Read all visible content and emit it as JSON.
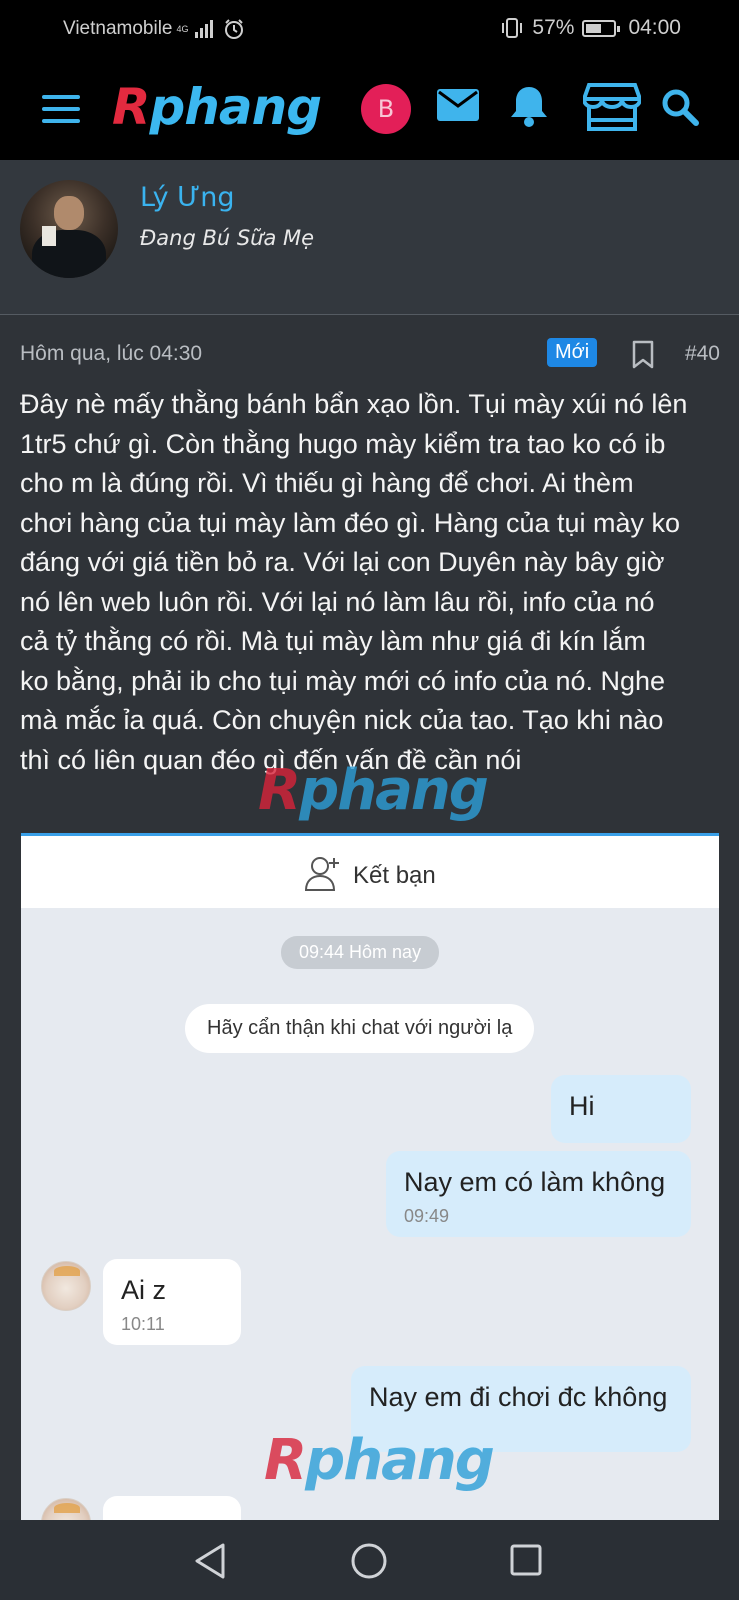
{
  "status_bar": {
    "carrier": "Vietnamobile",
    "network": "4G",
    "battery": "57%",
    "battery_level": 0.57,
    "time": "04:00"
  },
  "app_bar": {
    "logo_part1": "R",
    "logo_part2": "phang",
    "avatar_letter": "B",
    "icons": [
      "menu-icon",
      "mail-icon",
      "bell-icon",
      "store-icon",
      "search-icon"
    ]
  },
  "author": {
    "name": "Lý Ưng",
    "title": "Đang Bú Sữa Mẹ"
  },
  "post": {
    "date": "Hôm qua, lúc 04:30",
    "badge": "Mới",
    "number": "#40",
    "lines": [
      "Đây nè mấy thằng bánh bẩn xạo lồn. Tụi mày xúi nó lên",
      "1tr5 chứ gì. Còn thằng hugo mày kiểm tra tao ko có ib",
      "cho m là đúng rồi. Vì thiếu gì hàng để chơi. Ai thèm",
      "chơi hàng của tụi mày làm đéo gì. Hàng của tụi mày ko",
      "đáng với giá tiền bỏ ra. Với lại con Duyên này bây giờ",
      "nó lên web luôn rồi. Với lại nó làm lâu rồi, info của nó",
      "cả tỷ thằng có rồi. Mà tụi mày làm như giá đi kín lắm",
      "ko bằng, phải ib cho tụi mày mới có info của nó. Nghe",
      "mà mắc ỉa quá. Còn chuyện nick của tao. Tạo khi nào",
      "thì có liên quan đéo gì đến vấn đề cần nói"
    ]
  },
  "watermark": {
    "part1": "R",
    "part2": "phang"
  },
  "screenshot": {
    "header_label": "Kết bạn",
    "time_pill": "09:44 Hôm nay",
    "notice": "Hãy cẩn thận khi chat với người lạ",
    "messages": [
      {
        "from": "me",
        "text": "Hi",
        "time": ""
      },
      {
        "from": "me",
        "text": "Nay em có làm không",
        "time": "09:49"
      },
      {
        "from": "them",
        "text": "Ai z",
        "time": "10:11"
      },
      {
        "from": "me",
        "text": "Nay em đi chơi đc không",
        "time": ""
      }
    ]
  },
  "nav_bar": {
    "icons": [
      "back-icon",
      "home-icon",
      "recents-icon"
    ]
  }
}
